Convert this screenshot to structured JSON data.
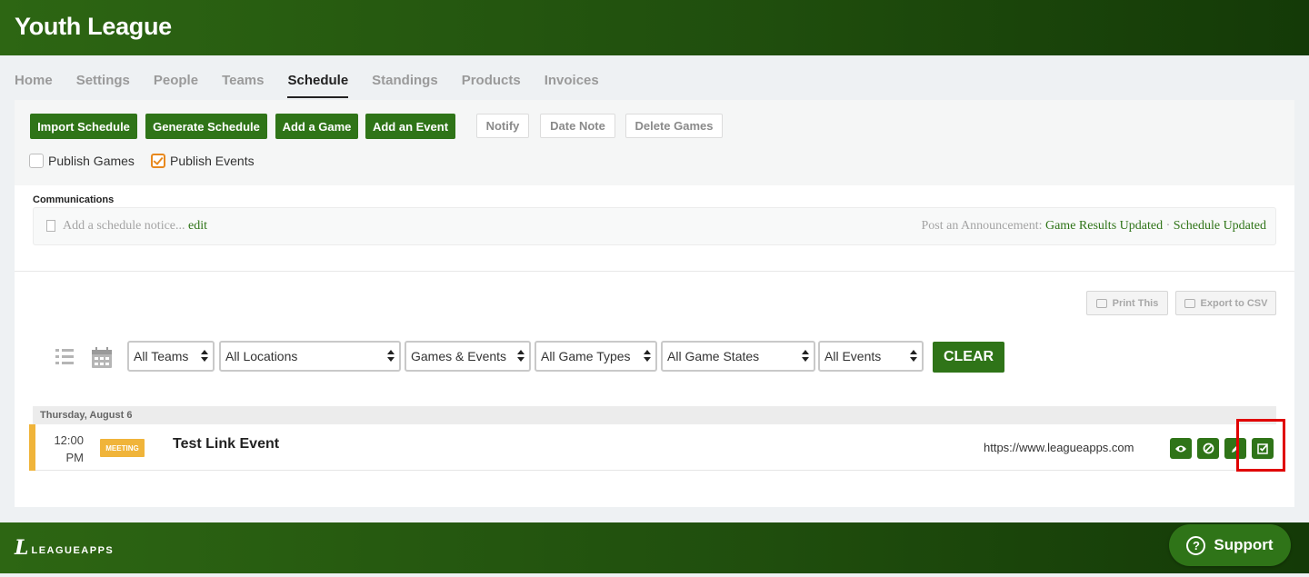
{
  "header": {
    "title": "Youth League"
  },
  "nav": {
    "tabs": [
      "Home",
      "Settings",
      "People",
      "Teams",
      "Schedule",
      "Standings",
      "Products",
      "Invoices"
    ]
  },
  "toolbar": {
    "import": "Import Schedule",
    "generate": "Generate Schedule",
    "add_game": "Add a Game",
    "add_event": "Add an Event",
    "notify": "Notify",
    "date_note": "Date Note",
    "delete_games": "Delete Games",
    "publish_games": "Publish Games",
    "publish_events": "Publish Events"
  },
  "communications": {
    "label": "Communications",
    "notice_placeholder": "Add a schedule notice...",
    "edit": "edit",
    "post_label": "Post an Announcement:",
    "link1": "Game Results Updated",
    "separator": "·",
    "link2": "Schedule Updated"
  },
  "actions": {
    "print": "Print This",
    "export": "Export to CSV"
  },
  "filters": {
    "teams": "All Teams",
    "locations": "All Locations",
    "games_events": "Games & Events",
    "game_types": "All Game Types",
    "game_states": "All Game States",
    "events": "All Events",
    "clear": "CLEAR"
  },
  "schedule": {
    "date": "Thursday, August 6",
    "event": {
      "time_line1": "12:00",
      "time_line2": "PM",
      "badge": "MEETING",
      "title": "Test Link Event",
      "link": "https://www.leagueapps.com"
    }
  },
  "footer": {
    "logo_text": "LEAGUEAPPS",
    "support": "Support"
  }
}
